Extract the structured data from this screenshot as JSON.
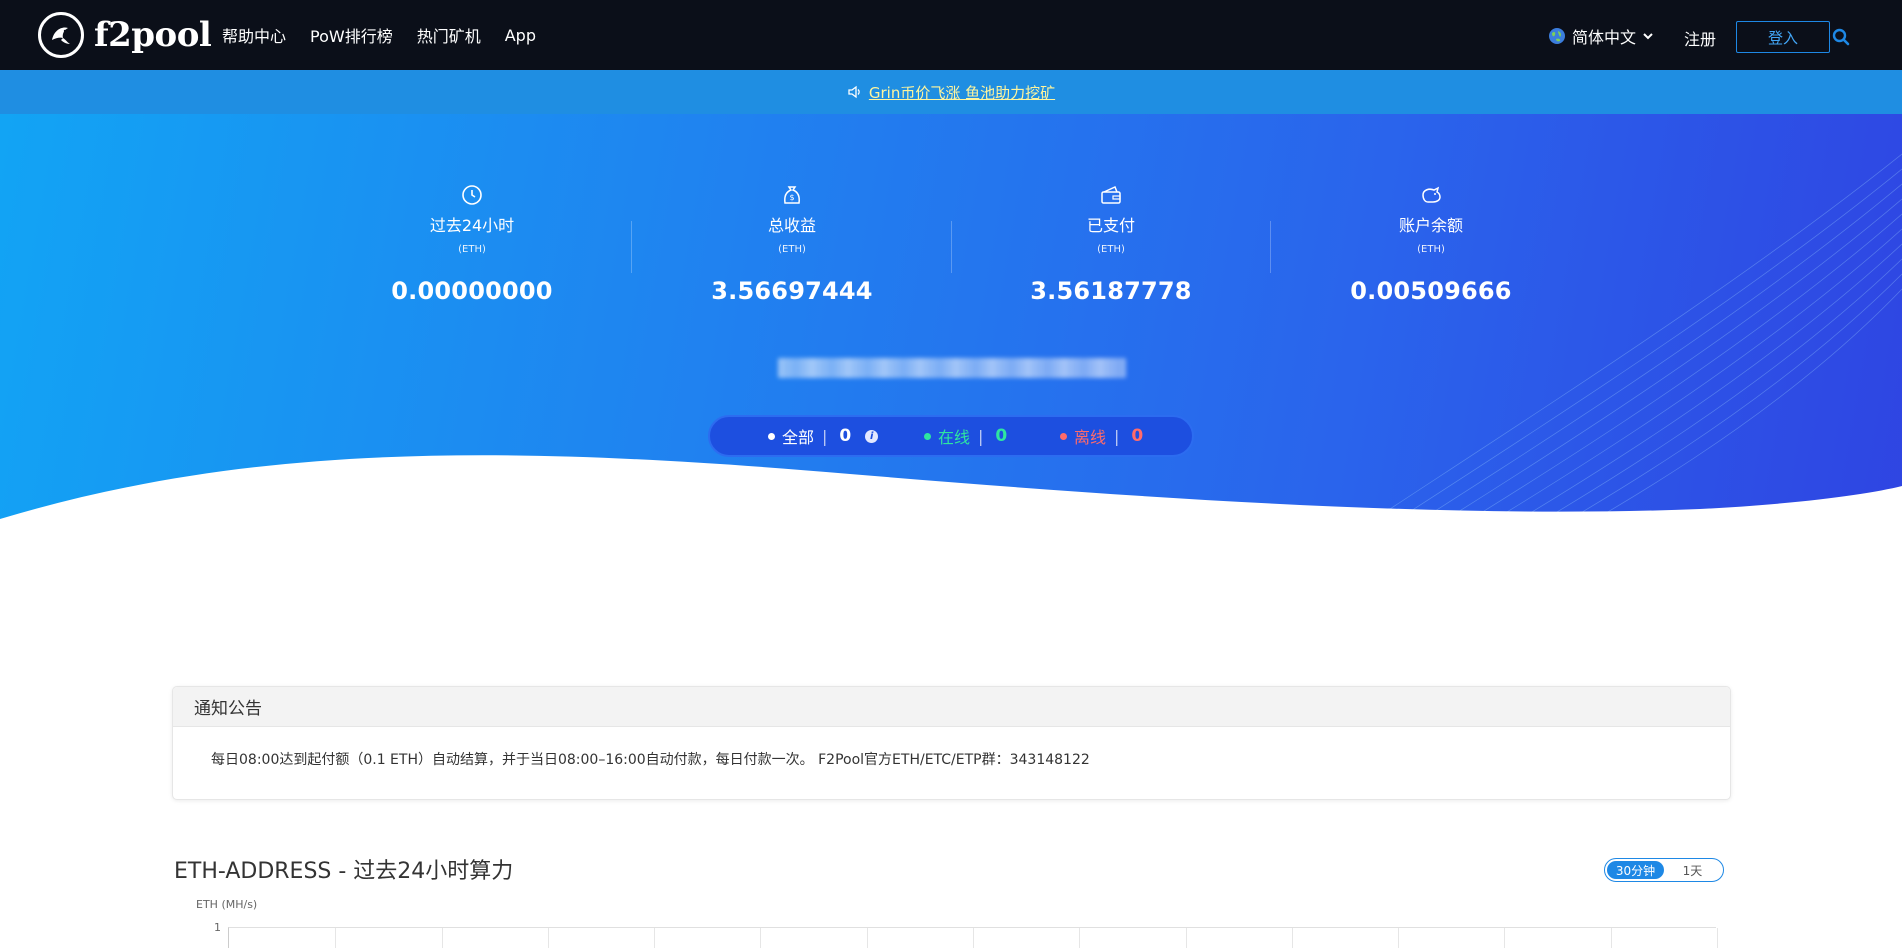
{
  "navbar": {
    "logo_text": "f2pool",
    "links": [
      "帮助中心",
      "PoW排行榜",
      "热门矿机",
      "App"
    ],
    "language": "简体中文",
    "register": "注册",
    "login": "登入"
  },
  "announcement_strip": {
    "link_text": "Grin币价飞涨 鱼池助力挖矿"
  },
  "stats": [
    {
      "label": "过去24小时",
      "unit": "(ETH)",
      "value": "0.00000000",
      "icon": "clock-icon"
    },
    {
      "label": "总收益",
      "unit": "(ETH)",
      "value": "3.56697444",
      "icon": "money-bag-icon"
    },
    {
      "label": "已支付",
      "unit": "(ETH)",
      "value": "3.56187778",
      "icon": "wallet-icon"
    },
    {
      "label": "账户余额",
      "unit": "(ETH)",
      "value": "0.00509666",
      "icon": "piggy-bank-icon"
    }
  ],
  "workers": {
    "all_label": "全部",
    "all_count": "0",
    "online_label": "在线",
    "online_count": "0",
    "offline_label": "离线",
    "offline_count": "0",
    "separator": "|",
    "info_glyph": "i"
  },
  "notice_card": {
    "title": "通知公告",
    "body": "每日08:00达到起付额（0.1 ETH）自动结算，并于当日08:00–16:00自动付款，每日付款一次。 F2Pool官方ETH/ETC/ETP群：343148122"
  },
  "chart": {
    "title": "ETH-ADDRESS - 过去24小时算力",
    "toggle_options": [
      "30分钟",
      "1天"
    ],
    "active_toggle": "30分钟",
    "y_unit": "ETH (MH/s)",
    "y_tick": "1"
  },
  "chart_data": {
    "type": "line",
    "title": "ETH-ADDRESS - 过去24小时算力",
    "ylabel": "ETH (MH/s)",
    "yticks": [
      1
    ],
    "series": []
  },
  "colors": {
    "online": "#2ee6a0",
    "offline": "#ff6b6b",
    "accent": "#1e88e5",
    "link_yellow": "#fff59d"
  }
}
